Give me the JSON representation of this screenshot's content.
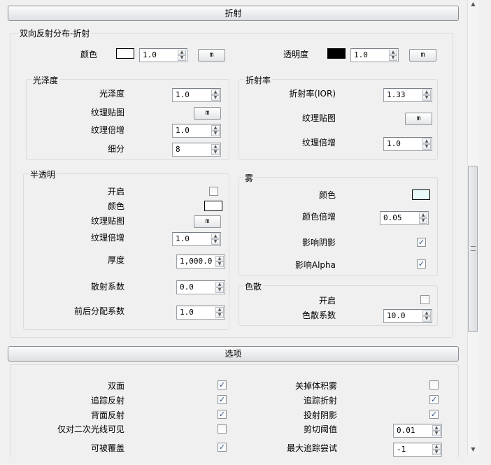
{
  "refraction": {
    "header": "折射",
    "brdf_group_title": "双向反射分布-折射",
    "color_label": "颜色",
    "color_value": "1.0",
    "color_swatch": "#ffffff",
    "transparency_label": "透明度",
    "transparency_value": "1.0",
    "transparency_swatch": "#000000",
    "map_button": "m",
    "glossiness": {
      "title": "光泽度",
      "gloss_label": "光泽度",
      "gloss_value": "1.0",
      "texture_label": "纹理贴图",
      "multiplier_label": "纹理倍增",
      "multiplier_value": "1.0",
      "subdiv_label": "细分",
      "subdiv_value": "8"
    },
    "ior": {
      "title": "折射率",
      "ior_label": "折射率(IOR)",
      "ior_value": "1.33",
      "texture_label": "纹理贴图",
      "multiplier_label": "纹理倍增",
      "multiplier_value": "1.0"
    },
    "translucency": {
      "title": "半透明",
      "enable_label": "开启",
      "enabled": false,
      "color_label": "颜色",
      "color_swatch": "#ffffff",
      "texture_label": "纹理贴图",
      "multiplier_label": "纹理倍增",
      "multiplier_value": "1.0",
      "thickness_label": "厚度",
      "thickness_value": "1,000.0",
      "scatter_label": "散射系数",
      "scatter_value": "0.0",
      "fwdbck_label": "前后分配系数",
      "fwdbck_value": "1.0"
    },
    "fog": {
      "title": "雾",
      "color_label": "颜色",
      "color_swatch": "#eafafa",
      "multiplier_label": "颜色倍增",
      "multiplier_value": "0.05",
      "affect_shadows_label": "影响阴影",
      "affect_shadows": true,
      "affect_alpha_label": "影响Alpha",
      "affect_alpha": true
    },
    "dispersion": {
      "title": "色散",
      "enable_label": "开启",
      "enabled": false,
      "abbe_label": "色散系数",
      "abbe_value": "10.0"
    }
  },
  "options": {
    "header": "选项",
    "double_sided_label": "双面",
    "double_sided": true,
    "trace_reflections_label": "追踪反射",
    "trace_reflections": true,
    "back_reflect_label": "背面反射",
    "back_reflect": true,
    "secondary_only_label": "仅对二次光线可见",
    "secondary_only": false,
    "can_override_label": "可被覆盖",
    "can_override": true,
    "disable_volume_fog_label": "关掉体积雾",
    "disable_volume_fog": false,
    "trace_refractions_label": "追踪折射",
    "trace_refractions": true,
    "cast_shadows_label": "投射阴影",
    "cast_shadows": true,
    "cutoff_label": "剪切阈值",
    "cutoff_value": "0.01",
    "max_trace_label": "最大追踪尝试",
    "max_trace_value": "-1"
  },
  "colors": {
    "check": "#2d4f8a"
  }
}
